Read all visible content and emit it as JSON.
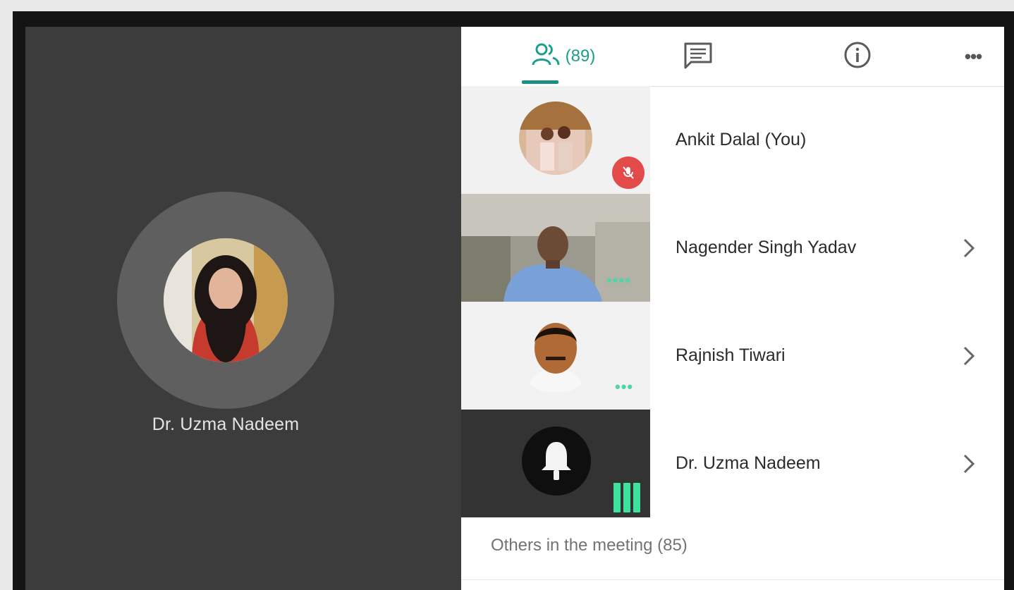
{
  "stage": {
    "speaker_name": "Dr. Uzma Nadeem"
  },
  "panel": {
    "tabs": {
      "people_count": "(89)",
      "people_icon": "people-icon",
      "chat_icon": "chat-icon",
      "info_icon": "info-icon",
      "more_icon": "more-horizontal-icon"
    },
    "participants": [
      {
        "name": "Ankit Dalal (You)",
        "status": "muted"
      },
      {
        "name": "Nagender Singh Yadav",
        "status": "dots"
      },
      {
        "name": "Rajnish Tiwari",
        "status": "dots"
      },
      {
        "name": "Dr. Uzma Nadeem",
        "status": "speaking"
      }
    ],
    "others_label": "Others in the meeting (85)"
  },
  "colors": {
    "accent": "#1a9e8e",
    "mic_off": "#e34b4b",
    "activity": "#3ee39b"
  }
}
